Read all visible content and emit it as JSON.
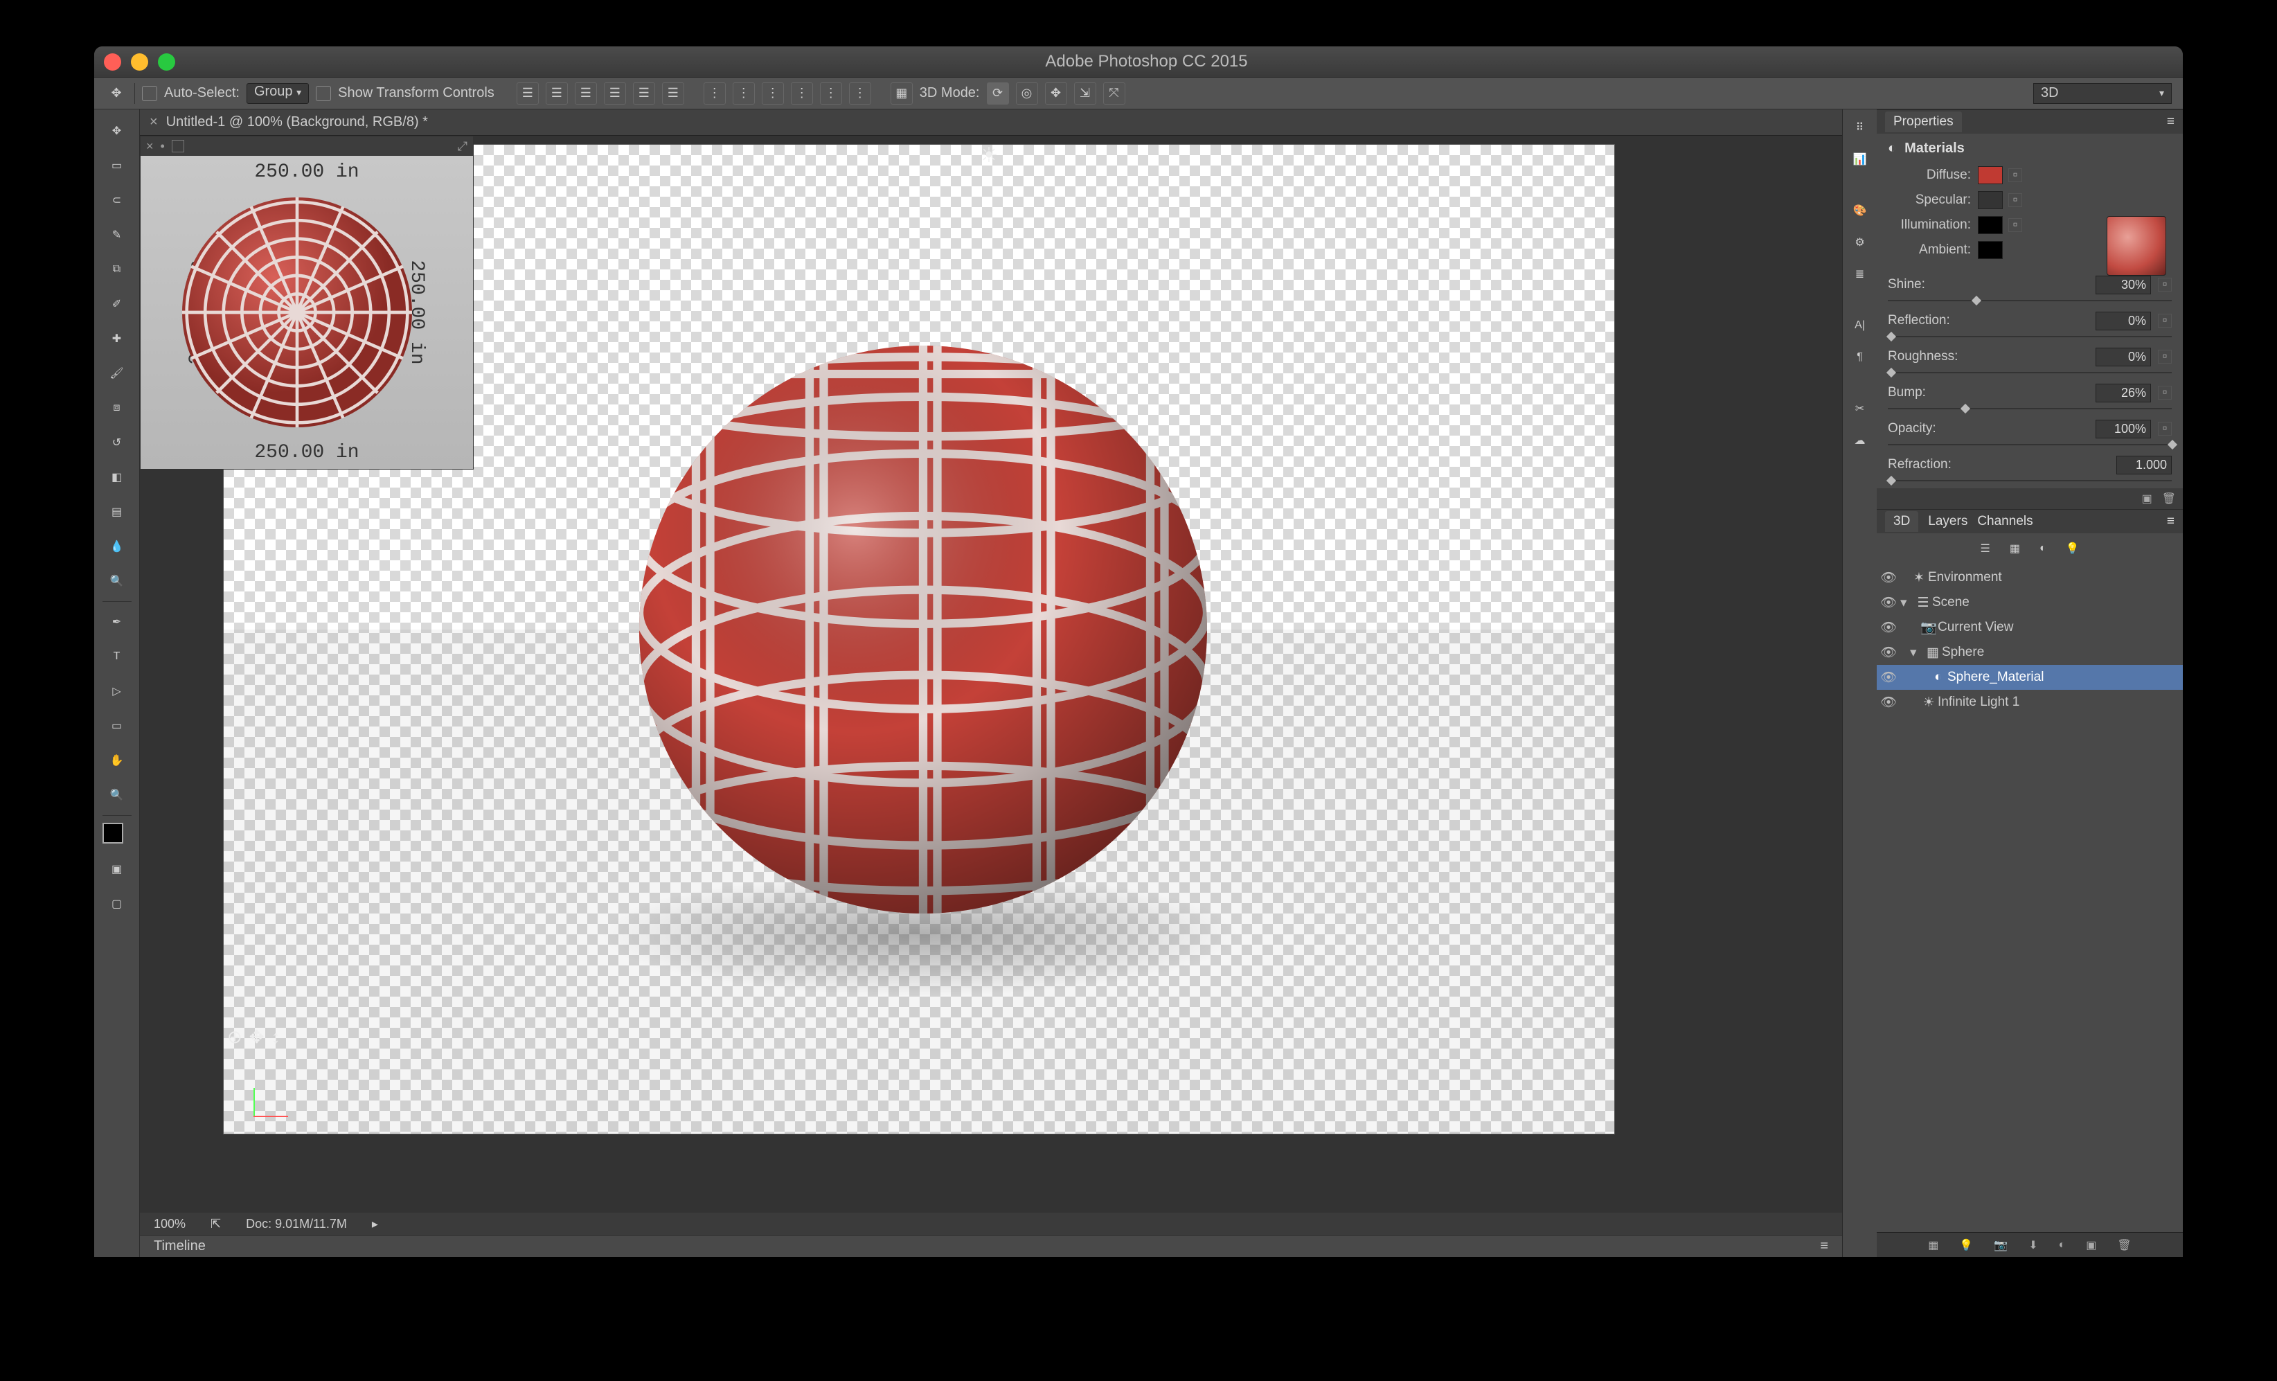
{
  "window": {
    "title": "Adobe Photoshop CC 2015"
  },
  "options_bar": {
    "auto_select_label": "Auto-Select:",
    "auto_select_value": "Group",
    "show_transform_label": "Show Transform Controls",
    "mode_label": "3D Mode:",
    "workspace_value": "3D"
  },
  "doc_tab": {
    "title": "Untitled-1 @ 100% (Background, RGB/8) *"
  },
  "uv_overlay": {
    "top": "250.00  in",
    "bottom": "250.00  in",
    "left": "250.00  in",
    "right": "250.00  in"
  },
  "status_bar": {
    "zoom": "100%",
    "doc": "Doc: 9.01M/11.7M"
  },
  "timeline": {
    "label": "Timeline"
  },
  "properties": {
    "panel_title": "Properties",
    "section": "Materials",
    "diffuse_label": "Diffuse:",
    "specular_label": "Specular:",
    "illumination_label": "Illumination:",
    "ambient_label": "Ambient:",
    "shine_label": "Shine:",
    "shine_value": "30%",
    "reflection_label": "Reflection:",
    "reflection_value": "0%",
    "roughness_label": "Roughness:",
    "roughness_value": "0%",
    "bump_label": "Bump:",
    "bump_value": "26%",
    "opacity_label": "Opacity:",
    "opacity_value": "100%",
    "refraction_label": "Refraction:",
    "refraction_value": "1.000",
    "colors": {
      "diffuse": "#c03a32",
      "specular": "#343434",
      "illumination": "#000000",
      "ambient": "#000000"
    }
  },
  "tabs": {
    "t3d": "3D",
    "layers": "Layers",
    "channels": "Channels"
  },
  "scene": {
    "environment": "Environment",
    "scene": "Scene",
    "current_view": "Current View",
    "sphere": "Sphere",
    "sphere_material": "Sphere_Material",
    "infinite_light": "Infinite Light 1"
  }
}
